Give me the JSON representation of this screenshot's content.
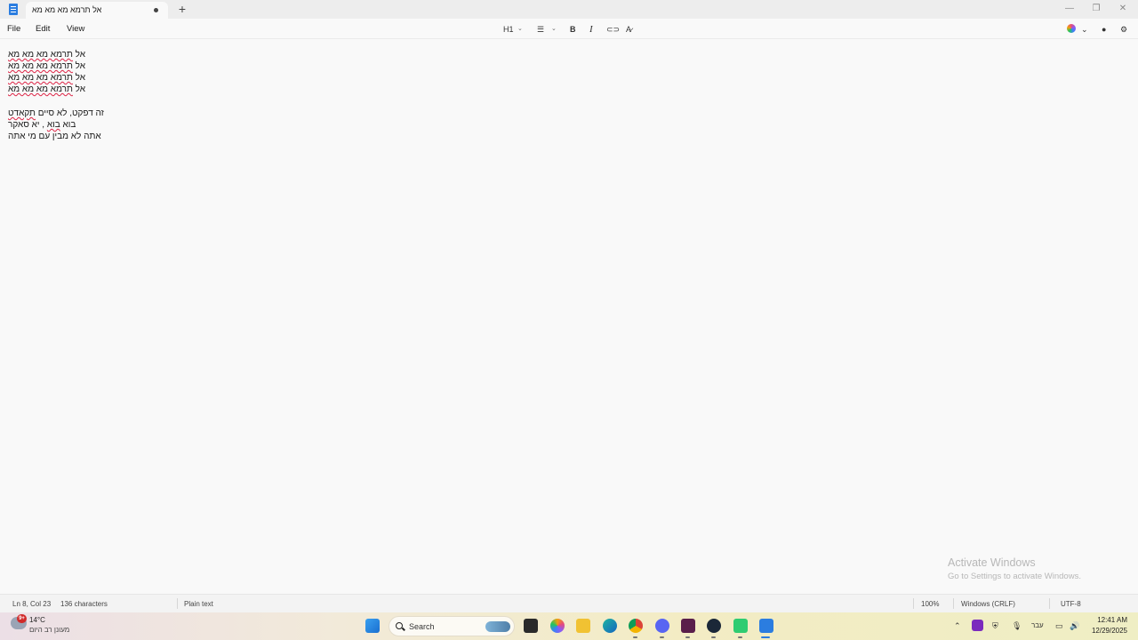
{
  "tab": {
    "title": "אל תרמא מא מא מא",
    "new_tab": "+"
  },
  "window_controls": {
    "minimize": "—",
    "maximize": "❐",
    "close": "✕"
  },
  "menu": {
    "file": "File",
    "edit": "Edit",
    "view": "View"
  },
  "toolbar": {
    "heading": "H1",
    "bold": "B",
    "italic": "I",
    "link": "🔗",
    "clear_format": "A̸"
  },
  "editor": {
    "lines": [
      {
        "plain": "אל ",
        "marked": "תרמא מא מא מא"
      },
      {
        "plain": "אל ",
        "marked": "תרמא מא מא מא"
      },
      {
        "plain": "אל ",
        "marked": "תרמא מא מא מא"
      },
      {
        "plain": "אל ",
        "marked": "תרמא מא מא מא"
      },
      {
        "plain": "",
        "marked": ""
      },
      {
        "plain": "זה דפקט, לא סיים ",
        "marked": "תקאדט"
      },
      {
        "plain": "בוא ",
        "marked": "בוא",
        "rest": " , יא סאקר"
      },
      {
        "plain": "אתה לא מבין עם מי אתה",
        "marked": ""
      }
    ]
  },
  "watermark": {
    "title": "Activate Windows",
    "subtitle": "Go to Settings to activate Windows."
  },
  "status": {
    "position": "Ln 8, Col 23",
    "characters": "136 characters",
    "format": "Plain text",
    "zoom": "100%",
    "line_ending": "Windows (CRLF)",
    "encoding": "UTF-8"
  },
  "taskbar": {
    "weather_temp": "14°C",
    "weather_desc": "מעונן רב היום",
    "weather_badge": "9+",
    "search_label": "Search",
    "language": "עבר",
    "time": "12:41 AM",
    "date": "12/29/2025"
  }
}
